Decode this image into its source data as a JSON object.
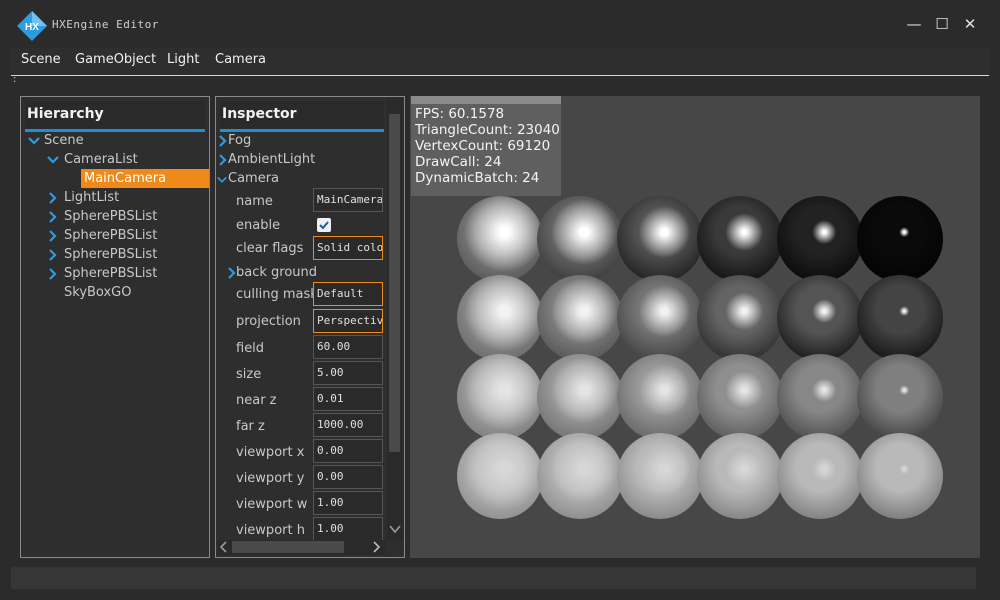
{
  "app": {
    "title": "HXEngine Editor",
    "logo_text": "HX"
  },
  "window_controls": {
    "minimize": "—",
    "maximize": "☐",
    "close": "✕"
  },
  "menu": [
    "Scene",
    "GameObject",
    "Light",
    "Camera"
  ],
  "menu_marker": ":",
  "hierarchy": {
    "title": "Hierarchy",
    "items": [
      {
        "label": "Scene",
        "expanded": true
      },
      {
        "label": "CameraList",
        "expanded": true
      },
      {
        "label": "MainCamera",
        "selected": true
      },
      {
        "label": "LightList",
        "expanded": false
      },
      {
        "label": "SpherePBSList",
        "expanded": false
      },
      {
        "label": "SpherePBSList",
        "expanded": false
      },
      {
        "label": "SpherePBSList",
        "expanded": false
      },
      {
        "label": "SpherePBSList",
        "expanded": false
      },
      {
        "label": "SkyBoxGO"
      }
    ]
  },
  "inspector": {
    "title": "Inspector",
    "sections": [
      {
        "label": "Fog",
        "expanded": false
      },
      {
        "label": "AmbientLight",
        "expanded": false
      },
      {
        "label": "Camera",
        "expanded": true
      }
    ],
    "fields": {
      "name": {
        "label": "name",
        "value": "MainCamera"
      },
      "enable": {
        "label": "enable",
        "checked": true
      },
      "clear_flags": {
        "label": "clear flags",
        "value": "Solid color"
      },
      "background": {
        "label": "back ground"
      },
      "culling_mask": {
        "label": "culling mask",
        "value": "Default"
      },
      "projection": {
        "label": "projection",
        "value": "Perspective"
      },
      "field": {
        "label": "field",
        "value": "60.00"
      },
      "size": {
        "label": "size",
        "value": "5.00"
      },
      "near_z": {
        "label": "near z",
        "value": "0.01"
      },
      "far_z": {
        "label": "far z",
        "value": "1000.00"
      },
      "viewport_x": {
        "label": "viewport x",
        "value": "0.00"
      },
      "viewport_y": {
        "label": "viewport y",
        "value": "0.00"
      },
      "viewport_w": {
        "label": "viewport w",
        "value": "1.00"
      },
      "viewport_h": {
        "label": "viewport h",
        "value": "1.00"
      }
    }
  },
  "stats": {
    "fps": "FPS: 60.1578",
    "triangles": "TriangleCount: 23040",
    "vertices": "VertexCount: 69120",
    "drawcalls": "DrawCall: 24",
    "batches": "DynamicBatch: 24"
  },
  "colors": {
    "accent": "#1e8ed6",
    "selection": "#ef8a1a",
    "background": "#2b2b2b"
  }
}
